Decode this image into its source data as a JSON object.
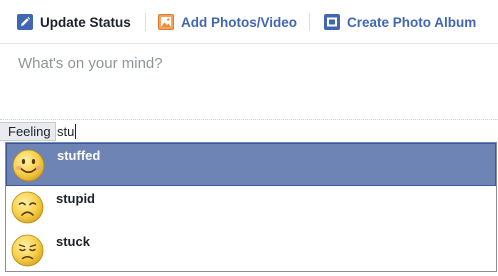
{
  "composer": {
    "tabs": [
      {
        "label": "Update Status",
        "icon": "pencil-icon",
        "active": true
      },
      {
        "label": "Add Photos/Video",
        "icon": "photo-icon",
        "active": false
      },
      {
        "label": "Create Photo Album",
        "icon": "album-icon",
        "active": false
      }
    ],
    "placeholder": "What's on your mind?"
  },
  "feeling": {
    "label": "Feeling",
    "query": "stu"
  },
  "suggestions": [
    {
      "label": "stuffed",
      "icon": "smiling-face-icon",
      "selected": true
    },
    {
      "label": "stupid",
      "icon": "frowning-face-icon",
      "selected": false
    },
    {
      "label": "stuck",
      "icon": "sad-face-icon",
      "selected": false
    }
  ],
  "colors": {
    "accent": "#4267b2",
    "selected_row": "#6d84b4",
    "emoji_face": "#f7d04b"
  }
}
